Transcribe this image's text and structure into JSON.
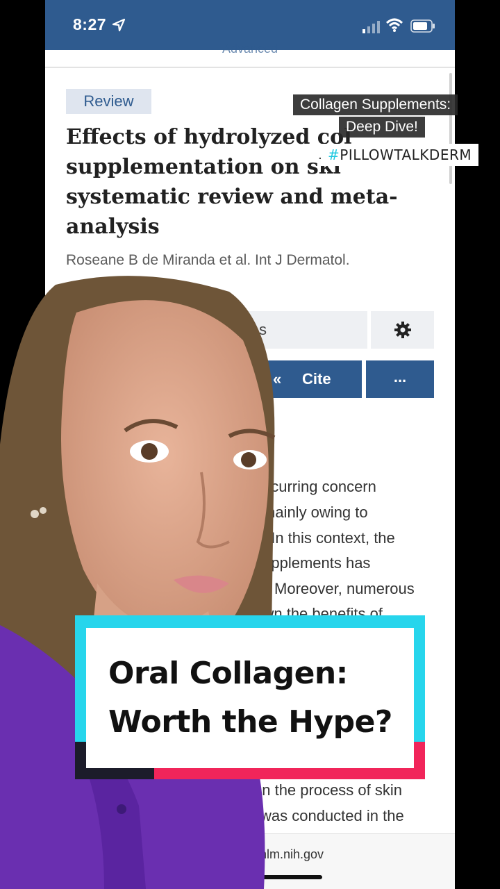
{
  "status_bar": {
    "time": "8:27"
  },
  "header": {
    "advanced_link": "Advanced"
  },
  "article": {
    "badge": "Review",
    "title": "Effects of hydrolyzed collagen supplementation on skin aging: a systematic review and meta-analysis",
    "title_visible_lines": [
      "Effects of hydrolyzed col",
      "supplementation on ski",
      "systematic review and meta-",
      "analysis"
    ],
    "authors": "Roseane B de Miranda et al. Int J Dermatol.",
    "full_text_partial": "s",
    "cite_label": "Cite",
    "more_label": "...",
    "body_lines": [
      "ecurring concern",
      "mainly owing to",
      ". In this context, the",
      "s supplements has",
      "ears. Moreover, numerous",
      "shown the benefits of",
      "on the process of skin",
      "was conducted in the"
    ]
  },
  "browser": {
    "url_fragment": "i.nlm.nih.gov"
  },
  "overlay": {
    "caption_line1": "Collagen Supplements:",
    "caption_line2": "Deep Dive!",
    "hashtag_mark": "#",
    "hashtag": "PILLOWTALKDERM",
    "card_line1": "Oral Collagen:",
    "card_line2": "Worth the Hype?"
  },
  "colors": {
    "pubmed_blue": "#2f5b8f",
    "card_cyan": "#27d5ec",
    "card_red": "#f1255a",
    "shirt_purple": "#6a2fb0"
  }
}
